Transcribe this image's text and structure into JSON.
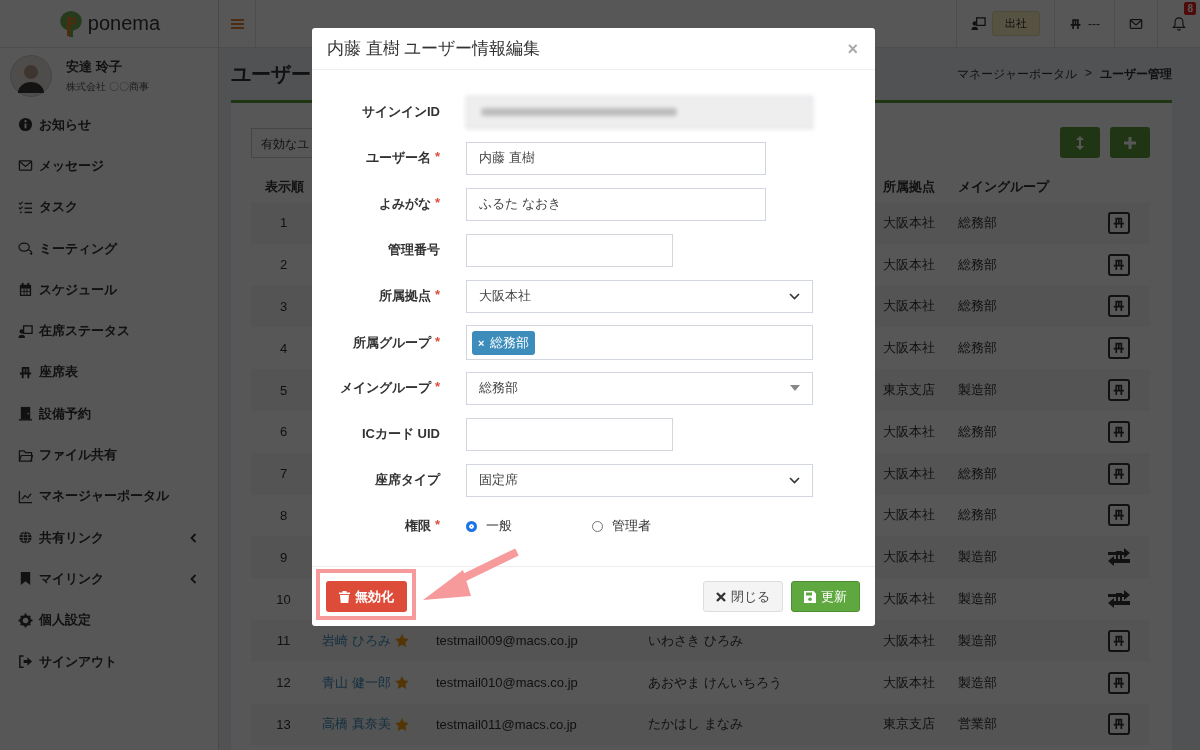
{
  "header": {
    "logo": "ponema",
    "status_badge": "出社",
    "seat_text": "---",
    "notification_count": "8"
  },
  "sidebar": {
    "user": {
      "name": "安達 玲子",
      "company": "株式会社 〇〇商事"
    },
    "items": [
      {
        "label": "お知らせ",
        "submenu": false
      },
      {
        "label": "メッセージ",
        "submenu": false
      },
      {
        "label": "タスク",
        "submenu": false
      },
      {
        "label": "ミーティング",
        "submenu": false
      },
      {
        "label": "スケジュール",
        "submenu": false
      },
      {
        "label": "在席ステータス",
        "submenu": false
      },
      {
        "label": "座席表",
        "submenu": false
      },
      {
        "label": "設備予約",
        "submenu": false
      },
      {
        "label": "ファイル共有",
        "submenu": false
      },
      {
        "label": "マネージャーポータル",
        "submenu": false
      },
      {
        "label": "共有リンク",
        "submenu": true
      },
      {
        "label": "マイリンク",
        "submenu": true
      },
      {
        "label": "個人設定",
        "submenu": false
      },
      {
        "label": "サインアウト",
        "submenu": false
      }
    ]
  },
  "page": {
    "title": "ユーザー",
    "breadcrumb": {
      "items": [
        "マネージャーポータル",
        "ユーザー管理"
      ],
      "separator": ">"
    },
    "filter": {
      "value": "有効なユ"
    }
  },
  "table": {
    "columns": [
      "表示順",
      "所属拠点",
      "メイングループ"
    ],
    "rows": [
      {
        "no": "1",
        "base": "大阪本社",
        "group": "総務部",
        "kind": "seat"
      },
      {
        "no": "2",
        "base": "大阪本社",
        "group": "総務部",
        "kind": "seat"
      },
      {
        "no": "3",
        "base": "大阪本社",
        "group": "総務部",
        "kind": "seat"
      },
      {
        "no": "4",
        "base": "大阪本社",
        "group": "総務部",
        "kind": "seat"
      },
      {
        "no": "5",
        "base": "東京支店",
        "group": "製造部",
        "kind": "seat"
      },
      {
        "no": "6",
        "base": "大阪本社",
        "group": "総務部",
        "kind": "seat"
      },
      {
        "no": "7",
        "base": "大阪本社",
        "group": "総務部",
        "kind": "seat"
      },
      {
        "no": "8",
        "base": "大阪本社",
        "group": "総務部",
        "kind": "seat"
      },
      {
        "no": "9",
        "base": "大阪本社",
        "group": "製造部",
        "kind": "swap"
      },
      {
        "no": "10",
        "base": "大阪本社",
        "group": "製造部",
        "kind": "swap"
      },
      {
        "no": "11",
        "name": "岩崎 ひろみ",
        "starred": true,
        "email": "testmail009@macs.co.jp",
        "kana": "いわさき ひろみ",
        "base": "大阪本社",
        "group": "製造部",
        "kind": "seat"
      },
      {
        "no": "12",
        "name": "青山 健一郎",
        "starred": true,
        "email": "testmail010@macs.co.jp",
        "kana": "あおやま けんいちろう",
        "base": "大阪本社",
        "group": "製造部",
        "kind": "seat"
      },
      {
        "no": "13",
        "name": "高橋 真奈美",
        "starred": true,
        "email": "testmail011@macs.co.jp",
        "kana": "たかはし まなみ",
        "base": "東京支店",
        "group": "営業部",
        "kind": "seat"
      }
    ]
  },
  "modal": {
    "title": "内藤 直樹 ユーザー情報編集",
    "close": "×",
    "fields": [
      {
        "label": "サインインID",
        "kind": "blurred"
      },
      {
        "label": "ユーザー名",
        "required_mark": "*",
        "kind": "text",
        "value": "内藤 直樹"
      },
      {
        "label": "よみがな",
        "required_mark": "*",
        "kind": "text",
        "value": "ふるた なおき"
      },
      {
        "label": "管理番号",
        "kind": "short-text"
      },
      {
        "label": "所属拠点",
        "required_mark": "*",
        "kind": "select",
        "value": "大阪本社"
      },
      {
        "label": "所属グループ",
        "required_mark": "*",
        "kind": "tags",
        "tags": [
          {
            "remove": "×",
            "label": "総務部"
          }
        ]
      },
      {
        "label": "メイングループ",
        "required_mark": "*",
        "kind": "combo",
        "value": "総務部"
      },
      {
        "label": "ICカード UID",
        "kind": "short-text"
      },
      {
        "label": "座席タイプ",
        "kind": "select",
        "value": "固定席"
      },
      {
        "label": "権限",
        "required_mark": "*",
        "kind": "radio",
        "options": [
          {
            "label": "一般",
            "selected": true
          },
          {
            "label": "管理者",
            "selected": false
          }
        ]
      }
    ],
    "buttons": [
      {
        "label": "無効化",
        "kind": "danger"
      },
      {
        "label": "閉じる",
        "kind": "close"
      },
      {
        "label": "更新",
        "kind": "save"
      }
    ]
  }
}
